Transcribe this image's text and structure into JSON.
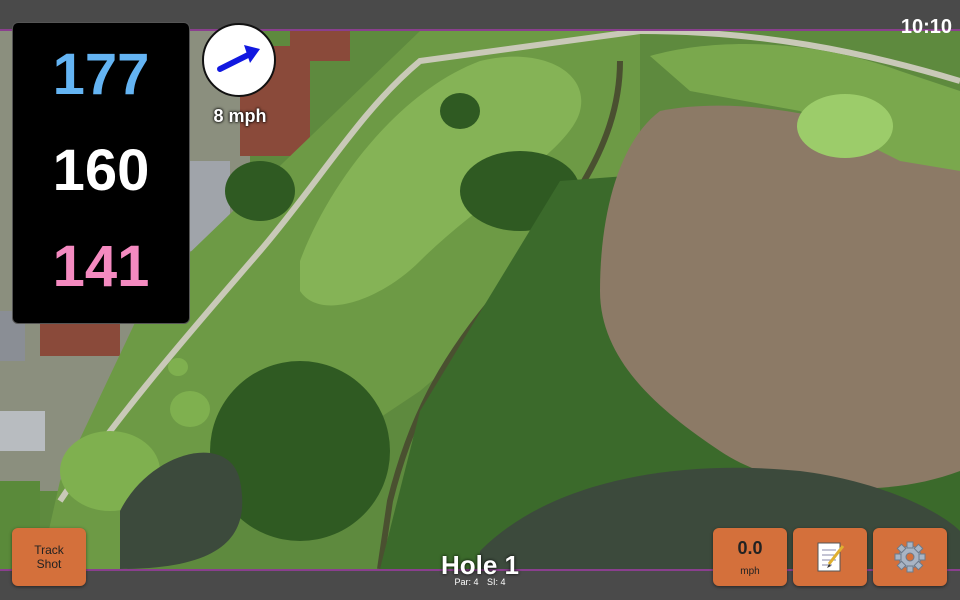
{
  "status": {
    "time": "10:10"
  },
  "distances": {
    "back": "177",
    "middle": "160",
    "front": "141"
  },
  "wind": {
    "speed_label": "8 mph",
    "direction_icon": "arrow-right-icon"
  },
  "hole": {
    "title": "Hole 1",
    "par": "Par: 4",
    "si": "SI: 4"
  },
  "buttons": {
    "track_line1": "Track",
    "track_line2": "Shot",
    "wind_value": "0.0",
    "wind_unit": "mph",
    "notes_icon": "notepad-icon",
    "settings_icon": "gear-icon"
  },
  "colors": {
    "back": "#64b4f3",
    "middle": "#ffffff",
    "front": "#f48ac0",
    "button": "#d4703b",
    "divider": "#8a3f8e"
  }
}
